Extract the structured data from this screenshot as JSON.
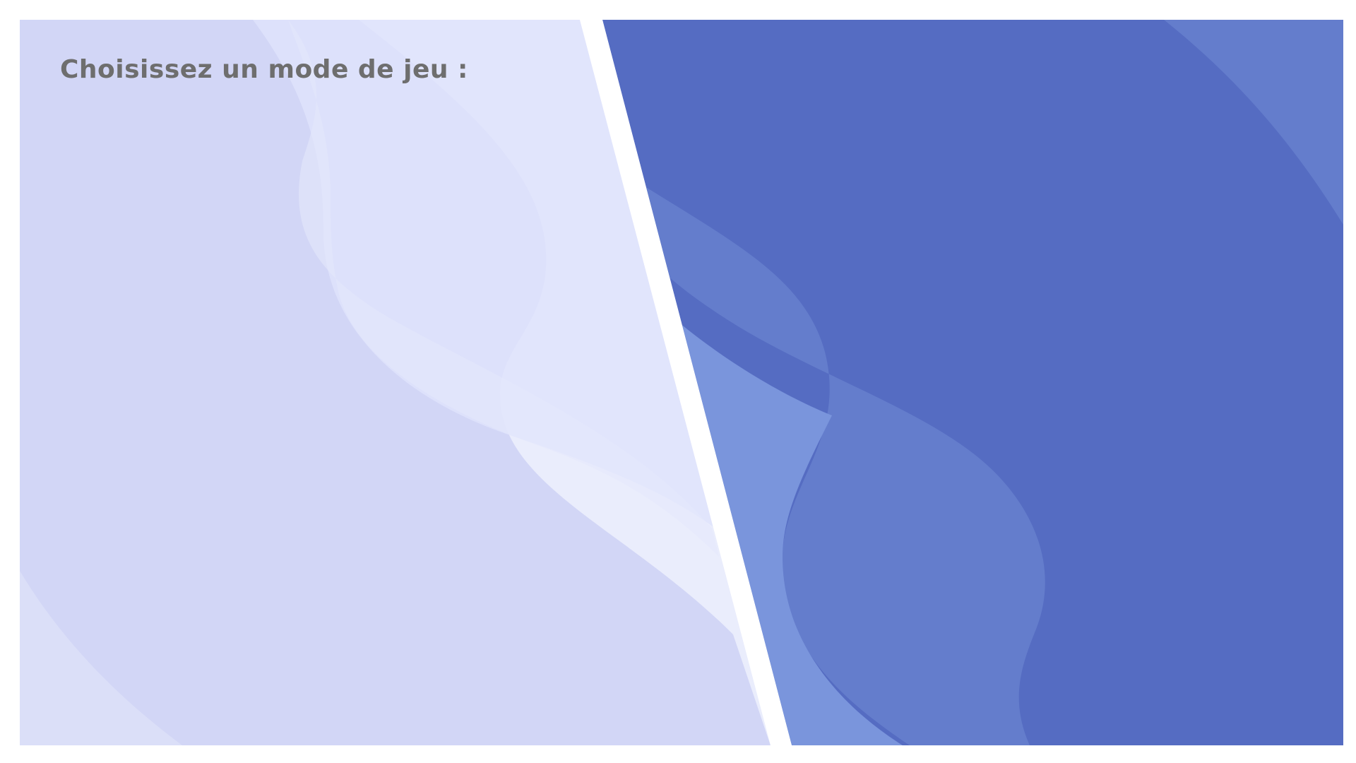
{
  "header": {
    "title": "Choisissez un mode de jeu :"
  },
  "modes": {
    "left": {
      "colors": {
        "base": "#d2d6f6",
        "wave_light": "#eaedfc",
        "wave_mid": "#dfe3fb"
      }
    },
    "right": {
      "colors": {
        "base": "#556cc2",
        "wave_mid": "#647dcc",
        "wave_light": "#7a95dc"
      }
    }
  },
  "divider": {
    "color": "#ffffff"
  }
}
